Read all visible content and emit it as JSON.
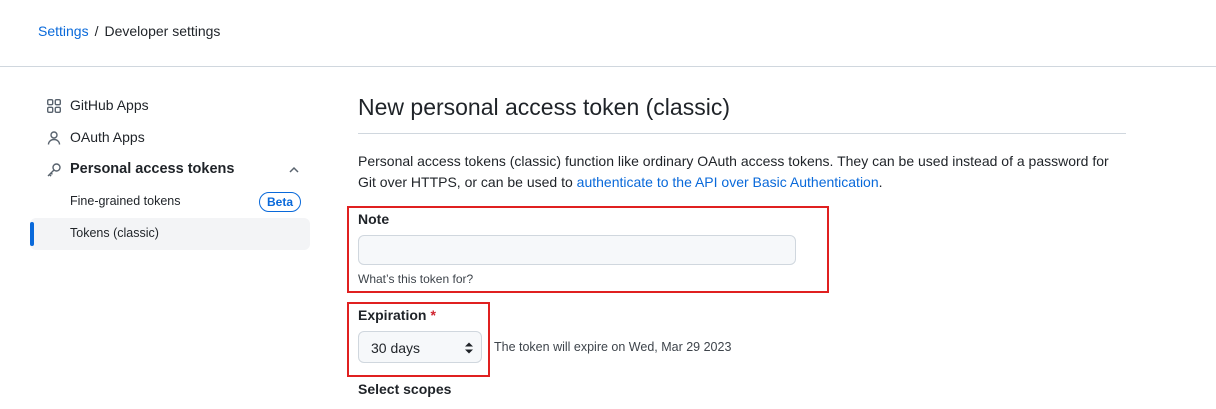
{
  "breadcrumb": {
    "parent": "Settings",
    "separator": "/",
    "current": "Developer settings"
  },
  "sidebar": {
    "items": [
      {
        "label": "GitHub Apps",
        "icon": "apps-grid-icon"
      },
      {
        "label": "OAuth Apps",
        "icon": "person-icon"
      },
      {
        "label": "Personal access tokens",
        "icon": "key-icon",
        "expanded": true
      }
    ],
    "sub_items": [
      {
        "label": "Fine-grained tokens",
        "badge": "Beta"
      },
      {
        "label": "Tokens (classic)",
        "active": true
      }
    ]
  },
  "main": {
    "title": "New personal access token (classic)",
    "description_text": "Personal access tokens (classic) function like ordinary OAuth access tokens. They can be used instead of a password for Git over HTTPS, or can be used to ",
    "description_link": "authenticate to the API over Basic Authentication",
    "description_end": ".",
    "note": {
      "label": "Note",
      "value": "",
      "hint": "What’s this token for?"
    },
    "expiration": {
      "label": "Expiration",
      "required_marker": "*",
      "selected": "30 days",
      "expiry_text": "The token will expire on Wed, Mar 29 2023"
    },
    "scopes_label": "Select scopes"
  },
  "colors": {
    "accent": "#0969da",
    "highlight": "#e02020",
    "required": "#cf222e"
  }
}
